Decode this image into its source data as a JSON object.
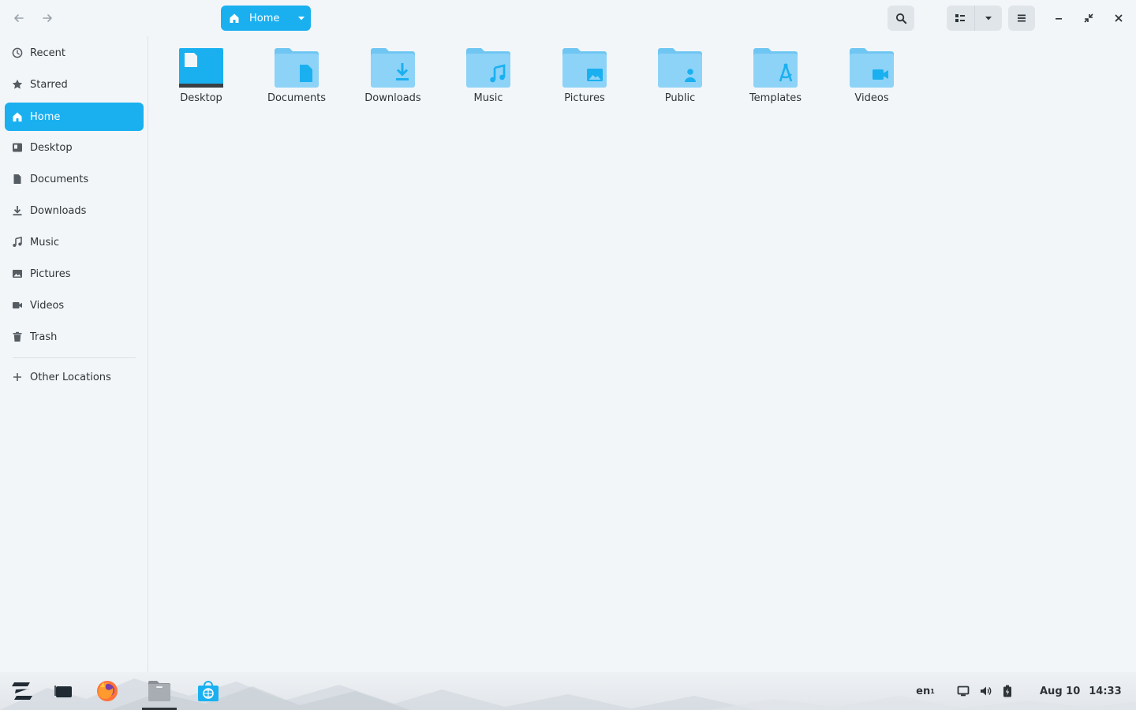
{
  "header": {
    "path_label": "Home"
  },
  "sidebar": {
    "items": [
      {
        "label": "Recent",
        "icon": "clock-icon"
      },
      {
        "label": "Starred",
        "icon": "star-icon"
      },
      {
        "label": "Home",
        "icon": "home-icon",
        "active": true
      },
      {
        "label": "Desktop",
        "icon": "desktop-icon"
      },
      {
        "label": "Documents",
        "icon": "document-icon"
      },
      {
        "label": "Downloads",
        "icon": "download-icon"
      },
      {
        "label": "Music",
        "icon": "music-icon"
      },
      {
        "label": "Pictures",
        "icon": "picture-icon"
      },
      {
        "label": "Videos",
        "icon": "video-icon"
      },
      {
        "label": "Trash",
        "icon": "trash-icon"
      }
    ],
    "other_locations": "Other Locations"
  },
  "files": [
    {
      "label": "Desktop",
      "icon": "desktop-folder-icon"
    },
    {
      "label": "Documents",
      "icon": "documents-folder-icon"
    },
    {
      "label": "Downloads",
      "icon": "downloads-folder-icon"
    },
    {
      "label": "Music",
      "icon": "music-folder-icon"
    },
    {
      "label": "Pictures",
      "icon": "pictures-folder-icon"
    },
    {
      "label": "Public",
      "icon": "public-folder-icon"
    },
    {
      "label": "Templates",
      "icon": "templates-folder-icon"
    },
    {
      "label": "Videos",
      "icon": "videos-folder-icon"
    }
  ],
  "taskbar": {
    "keyboard_layout": "en",
    "keyboard_layout_sub": "1",
    "date": "Aug 10",
    "time": "14:33"
  },
  "colors": {
    "accent": "#1ab0f0",
    "folder": "#8dd3f7",
    "folder_tab": "#6fc6f3",
    "folder_glyph": "#1ab0f0",
    "background": "#f3f6f9"
  }
}
